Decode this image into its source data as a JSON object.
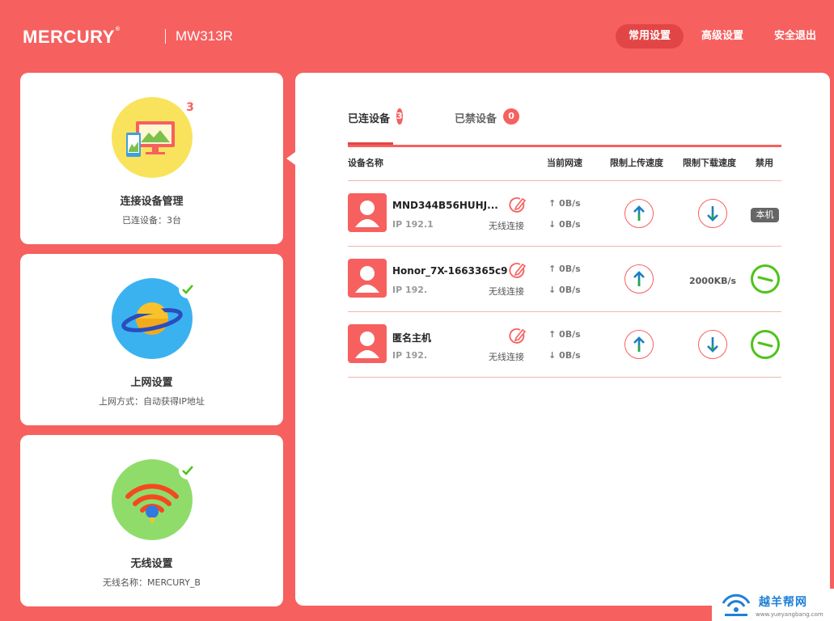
{
  "header": {
    "brand": "MERCURY",
    "brand_mark": "®",
    "model": "MW313R",
    "nav": [
      "常用设置",
      "高级设置",
      "安全退出"
    ]
  },
  "cards": [
    {
      "title": "连接设备管理",
      "subtitle": "已连设备：3台",
      "badge": "3",
      "icon": "devices-icon"
    },
    {
      "title": "上网设置",
      "subtitle": "上网方式：自动获得IP地址",
      "icon": "planet-icon",
      "status": "check-icon"
    },
    {
      "title": "无线设置",
      "subtitle": "无线名称：MERCURY_B",
      "icon": "wifi-icon",
      "status": "check-icon"
    }
  ],
  "tabs": [
    {
      "label": "已连设备",
      "count": "3"
    },
    {
      "label": "已禁设备",
      "count": "0"
    }
  ],
  "table": {
    "headers": [
      "设备名称",
      "当前网速",
      "限制上传速度",
      "限制下载速度",
      "禁用"
    ],
    "rows": [
      {
        "name": "MND344B56HUHJ...",
        "ip": "IP 192.1",
        "conn": "无线连接",
        "up": "0B/s",
        "down": "0B/s",
        "download_limit": "",
        "ban": "本机"
      },
      {
        "name": "Honor_7X-1663365c9",
        "ip": "IP 192.",
        "conn": "无线连接",
        "up": "0B/s",
        "down": "0B/s",
        "download_limit": "2000KB/s",
        "ban": ""
      },
      {
        "name": "匿名主机",
        "ip": "IP 192.",
        "conn": "无线连接",
        "up": "0B/s",
        "down": "0B/s",
        "download_limit": "",
        "ban": ""
      }
    ]
  },
  "watermark": {
    "text": "越羊帮网",
    "url": "www.yueyangbang.com"
  },
  "colors": {
    "brand": "#f6605f",
    "accent_dark": "#e24545",
    "ok_green": "#4ec31b",
    "arrow_blue": "#1c7fc0",
    "arrow_green": "#27a64a"
  }
}
